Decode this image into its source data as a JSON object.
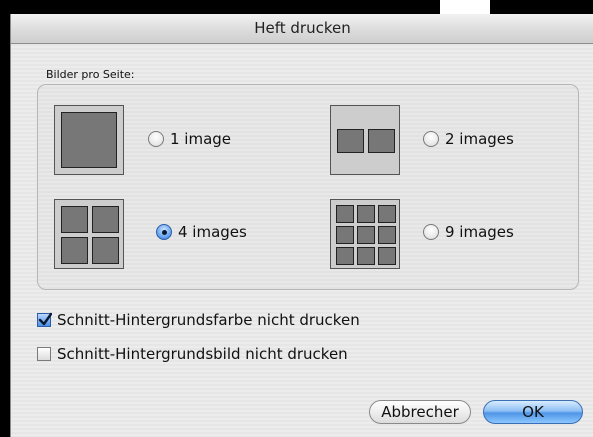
{
  "dialog": {
    "title": "Heft drucken",
    "section_label": "Bilder pro Seite:"
  },
  "layout_options": [
    {
      "label": "1 image",
      "selected": false,
      "icon": "one-image-layout-icon"
    },
    {
      "label": "2 images",
      "selected": false,
      "icon": "two-images-layout-icon"
    },
    {
      "label": "4 images",
      "selected": true,
      "icon": "four-images-layout-icon"
    },
    {
      "label": "9 images",
      "selected": false,
      "icon": "nine-images-layout-icon"
    }
  ],
  "checkboxes": [
    {
      "label": "Schnitt-Hintergrundsfarbe nicht drucken",
      "checked": true
    },
    {
      "label": "Schnitt-Hintergrundsbild nicht drucken",
      "checked": false
    }
  ],
  "buttons": {
    "cancel_label": "Abbrecher",
    "ok_label": "OK"
  },
  "colors": {
    "accent": "#4f95e6",
    "thumb_cell": "#777777"
  }
}
